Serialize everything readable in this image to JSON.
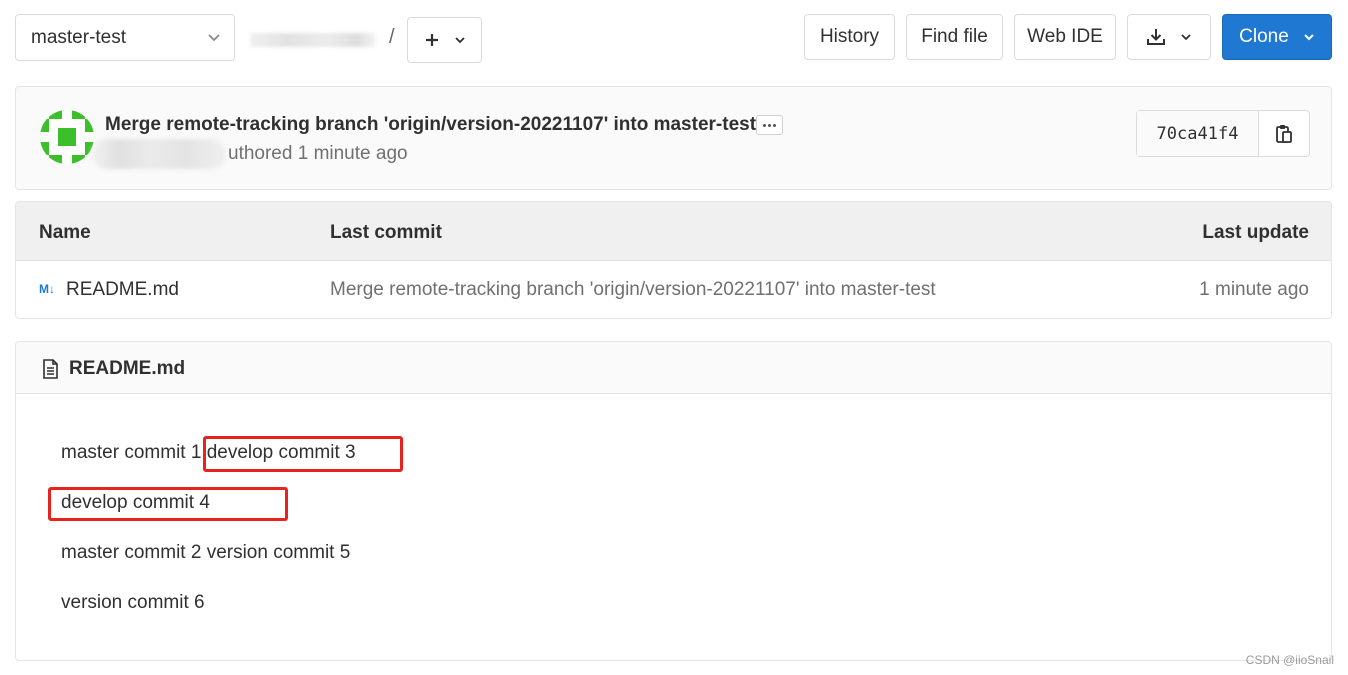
{
  "toolbar": {
    "branch": "master-test",
    "path_separator": "/",
    "history_label": "History",
    "find_file_label": "Find file",
    "web_ide_label": "Web IDE",
    "clone_label": "Clone"
  },
  "last_commit": {
    "title": "Merge remote-tracking branch 'origin/version-20221107' into master-test",
    "authored_text": "uthored 1 minute ago",
    "sha": "70ca41f4"
  },
  "file_tree": {
    "columns": [
      "Name",
      "Last commit",
      "Last update"
    ],
    "rows": [
      {
        "icon_text": "M↓",
        "name": "README.md",
        "last_commit": "Merge remote-tracking branch 'origin/version-20221107' into master-test",
        "last_update": "1 minute ago"
      }
    ]
  },
  "readme": {
    "title": "README.md",
    "lines": [
      "master commit 1 develop commit 3",
      "develop commit 4",
      "master commit 2 version commit 5",
      "version commit 6"
    ]
  },
  "watermark": "CSDN @iioSnail",
  "colors": {
    "clone_button": "#1f78d1",
    "highlight_box": "#e8221f",
    "avatar_green": "#3dbf2c"
  },
  "icons": {
    "branch_dropdown": "chevron-down-icon",
    "add": "plus-icon",
    "download": "download-icon",
    "copy": "clipboard-icon",
    "readme": "file-text-icon",
    "markdown": "markdown-icon"
  }
}
